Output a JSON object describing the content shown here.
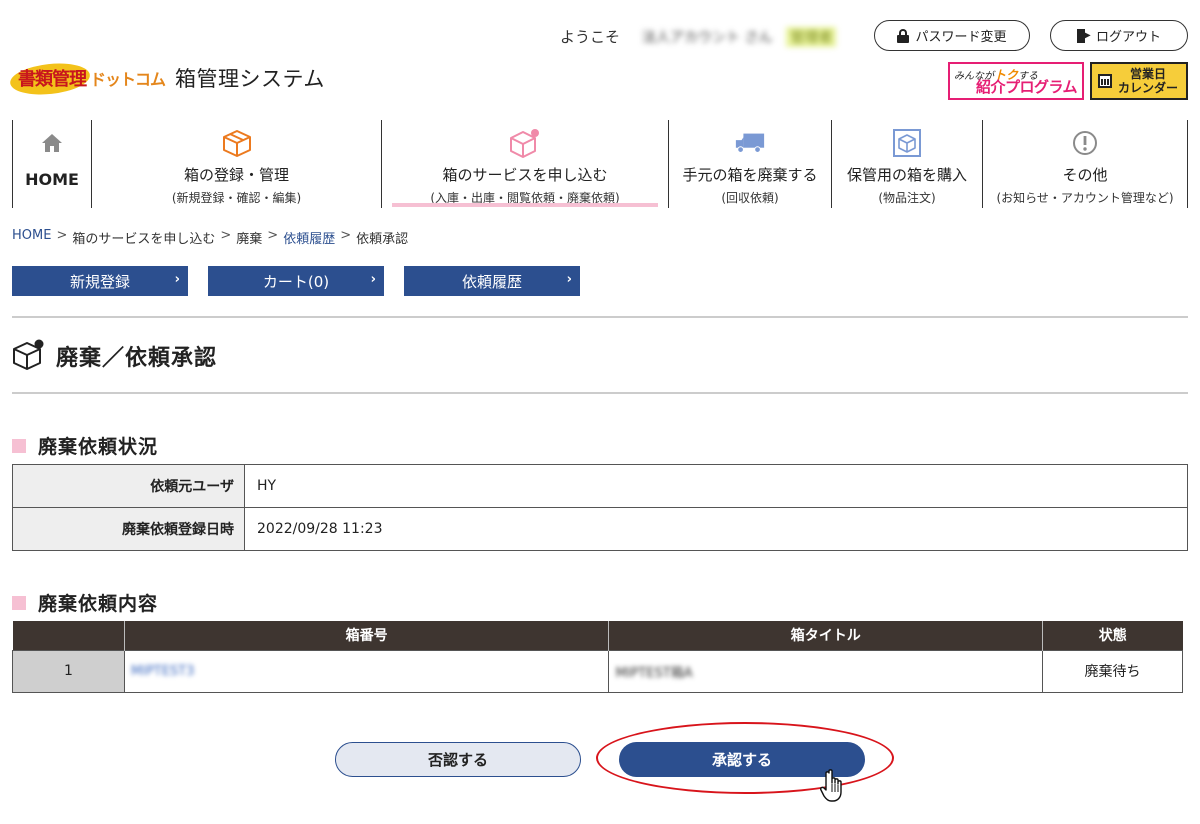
{
  "header": {
    "logo_kanri": "書類管理",
    "logo_dotcom": "ドットコム",
    "system_name": "箱管理システム",
    "welcome": "ようこそ",
    "user_name": "法人アカウント さん",
    "user_role": "管理者",
    "password_button": "パスワード変更",
    "logout_button": "ログアウト",
    "banner_intro_top": "みんなが",
    "banner_intro_toku": "トク",
    "banner_intro_suru": "する",
    "banner_intro_main": "紹介プログラム",
    "banner_cal_line1": "営業日",
    "banner_cal_line2": "カレンダー"
  },
  "nav": {
    "home": "HOME",
    "items": [
      {
        "title": "箱の登録・管理",
        "sub": "(新規登録・確認・編集)"
      },
      {
        "title": "箱のサービスを申し込む",
        "sub": "(入庫・出庫・閲覧依頼・廃棄依頼)"
      },
      {
        "title": "手元の箱を廃棄する",
        "sub": "(回収依頼)"
      },
      {
        "title": "保管用の箱を購入",
        "sub": "(物品注文)"
      },
      {
        "title": "その他",
        "sub": "(お知らせ・アカウント管理など)"
      }
    ]
  },
  "breadcrumb": {
    "home": "HOME",
    "service": "箱のサービスを申し込む",
    "disposal": "廃棄",
    "history": "依頼履歴",
    "current": "依頼承認",
    "separator": ">"
  },
  "actions": {
    "new": "新規登録",
    "cart": "カート(0)",
    "history": "依頼履歴",
    "chevron": "›"
  },
  "page": {
    "title": "廃棄／依頼承認"
  },
  "status_section": {
    "title": "廃棄依頼状況",
    "rows": [
      {
        "label": "依頼元ユーザ",
        "value": "HY"
      },
      {
        "label": "廃棄依頼登録日時",
        "value": "2022/09/28 11:23"
      }
    ]
  },
  "content_section": {
    "title": "廃棄依頼内容",
    "headers": [
      "",
      "箱番号",
      "箱タイトル",
      "状態"
    ],
    "rows": [
      {
        "index": "1",
        "box_number": "MIPTEST3",
        "box_title": "MIPTEST箱A",
        "status": "廃棄待ち"
      }
    ]
  },
  "buttons": {
    "reject": "否認する",
    "approve": "承認する"
  },
  "colors": {
    "primary": "#2c4f8f",
    "accent_pink": "#f6c0d3",
    "table_header": "#3e3530",
    "highlight": "#d8141b"
  }
}
